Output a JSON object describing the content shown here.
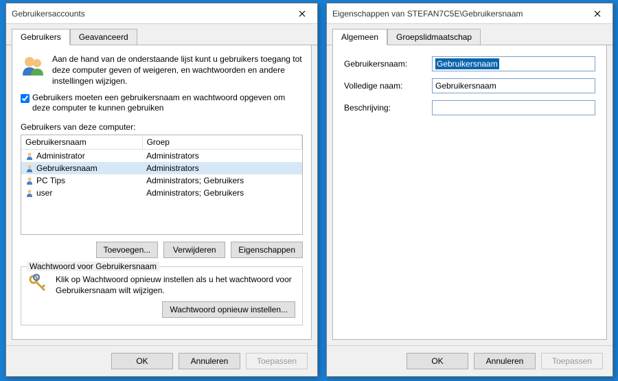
{
  "left": {
    "title": "Gebruikersaccounts",
    "tabs": {
      "users": "Gebruikers",
      "advanced": "Geavanceerd"
    },
    "intro": "Aan de hand van de onderstaande lijst kunt u gebruikers toegang tot deze computer geven of weigeren, en wachtwoorden en andere instellingen wijzigen.",
    "checkbox_label": "Gebruikers moeten een gebruikersnaam en wachtwoord opgeven om deze computer te kunnen gebruiken",
    "list_label": "Gebruikers van deze computer:",
    "columns": {
      "name": "Gebruikersnaam",
      "group": "Groep"
    },
    "rows": [
      {
        "name": "Administrator",
        "group": "Administrators",
        "selected": false
      },
      {
        "name": "Gebruikersnaam",
        "group": "Administrators",
        "selected": true
      },
      {
        "name": "PC Tips",
        "group": "Administrators; Gebruikers",
        "selected": false
      },
      {
        "name": "user",
        "group": "Administrators; Gebruikers",
        "selected": false
      }
    ],
    "buttons": {
      "add": "Toevoegen...",
      "remove": "Verwijderen",
      "props": "Eigenschappen"
    },
    "group": {
      "legend": "Wachtwoord voor Gebruikersnaam",
      "text": "Klik op Wachtwoord opnieuw instellen als u het wachtwoord voor Gebruikersnaam wilt wijzigen.",
      "reset": "Wachtwoord opnieuw instellen..."
    },
    "bottom": {
      "ok": "OK",
      "cancel": "Annuleren",
      "apply": "Toepassen"
    }
  },
  "right": {
    "title": "Eigenschappen van STEFAN7C5E\\Gebruikersnaam",
    "tabs": {
      "general": "Algemeen",
      "membership": "Groepslidmaatschap"
    },
    "fields": {
      "username_label": "Gebruikersnaam:",
      "username_value": "Gebruikersnaam",
      "fullname_label": "Volledige naam:",
      "fullname_value": "Gebruikersnaam",
      "desc_label": "Beschrijving:",
      "desc_value": ""
    },
    "bottom": {
      "ok": "OK",
      "cancel": "Annuleren",
      "apply": "Toepassen"
    }
  }
}
